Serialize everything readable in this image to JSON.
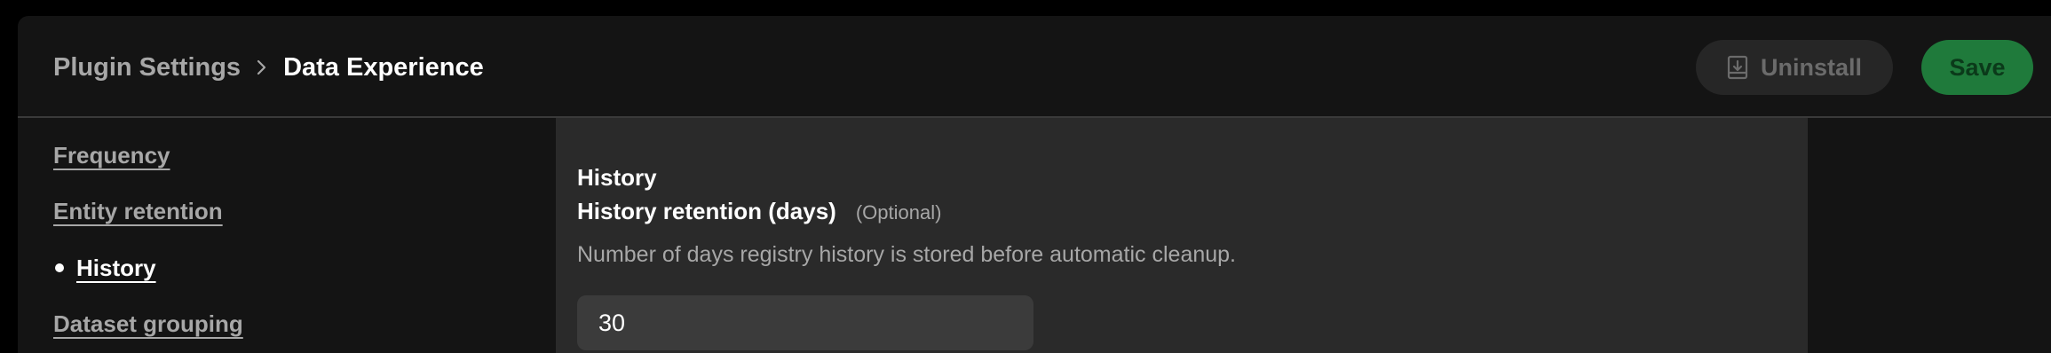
{
  "header": {
    "breadcrumb_parent": "Plugin Settings",
    "breadcrumb_separator": "›",
    "breadcrumb_current": "Data Experience",
    "uninstall_label": "Uninstall",
    "save_label": "Save"
  },
  "sidebar": {
    "items": [
      {
        "label": "Frequency",
        "active": false
      },
      {
        "label": "Entity retention",
        "active": false
      },
      {
        "label": "History",
        "active": true
      },
      {
        "label": "Dataset grouping",
        "active": false
      }
    ]
  },
  "main": {
    "section_title": "History",
    "field": {
      "label": "History retention (days)",
      "optional_tag": "(Optional)",
      "description": "Number of days registry history is stored before automatic cleanup.",
      "value": "30"
    }
  },
  "colors": {
    "background": "#141414",
    "panel": "#2a2a2a",
    "input": "#3b3b3b",
    "save_button": "#1f7a3b",
    "muted_text": "#a7a7a7"
  },
  "icons": {
    "uninstall": "uninstall-icon",
    "separator": "chevron-right-icon"
  }
}
